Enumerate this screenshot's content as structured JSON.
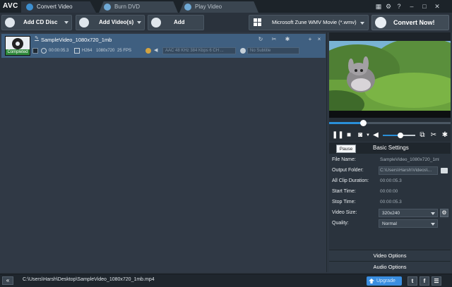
{
  "app": {
    "logo": "AVC"
  },
  "tabs": [
    {
      "label": "Convert Video"
    },
    {
      "label": "Burn DVD"
    },
    {
      "label": "Play Video"
    }
  ],
  "toolbar": {
    "add_cd_label": "Add CD Disc",
    "add_videos_label": "Add Video(s)",
    "add_urls_label": "Add URL(s)",
    "profile_label": "Microsoft Zune WMV Movie (*.wmv)",
    "convert_label": "Convert Now!"
  },
  "file_item": {
    "name": "SampleVideo_1080x720_1mb",
    "status": "Completed",
    "duration": "00:00:05.3",
    "codec": "H264",
    "resolution": "1080x720",
    "fps": "25 FPS",
    "audio_track": "AAC 48 KHz 384 Kbps 6 CH ...",
    "subtitle": "No Subtitle"
  },
  "player": {
    "seek_progress": 0.28,
    "volume_level": 0.55
  },
  "settings": {
    "tooltip": "Pause",
    "title": "Basic Settings",
    "rows": [
      {
        "key": "File Name:",
        "value": "SampleVideo_1080x720_1mb"
      },
      {
        "key": "Output Folder:",
        "value": "C:\\Users\\Harsh\\Videos\\..."
      },
      {
        "key": "All Clip Duration:",
        "value": "00:00:05.3"
      },
      {
        "key": "Start Time:",
        "value": "00:00:00"
      },
      {
        "key": "Stop Time:",
        "value": "00:00:05.3"
      },
      {
        "key": "Video Size:",
        "value": "320x240"
      },
      {
        "key": "Quality:",
        "value": "Normal"
      }
    ],
    "video_options": "Video Options",
    "audio_options": "Audio Options"
  },
  "statusbar": {
    "path": "C:\\Users\\Harsh\\Desktop\\SampleVideo_1080x720_1mb.mp4",
    "upgrade_label": "Upgrade"
  },
  "colors": {
    "accent": "#2a8fd8",
    "selected_item": "#3f5f80",
    "completed_badge": "#2f8a3c"
  }
}
